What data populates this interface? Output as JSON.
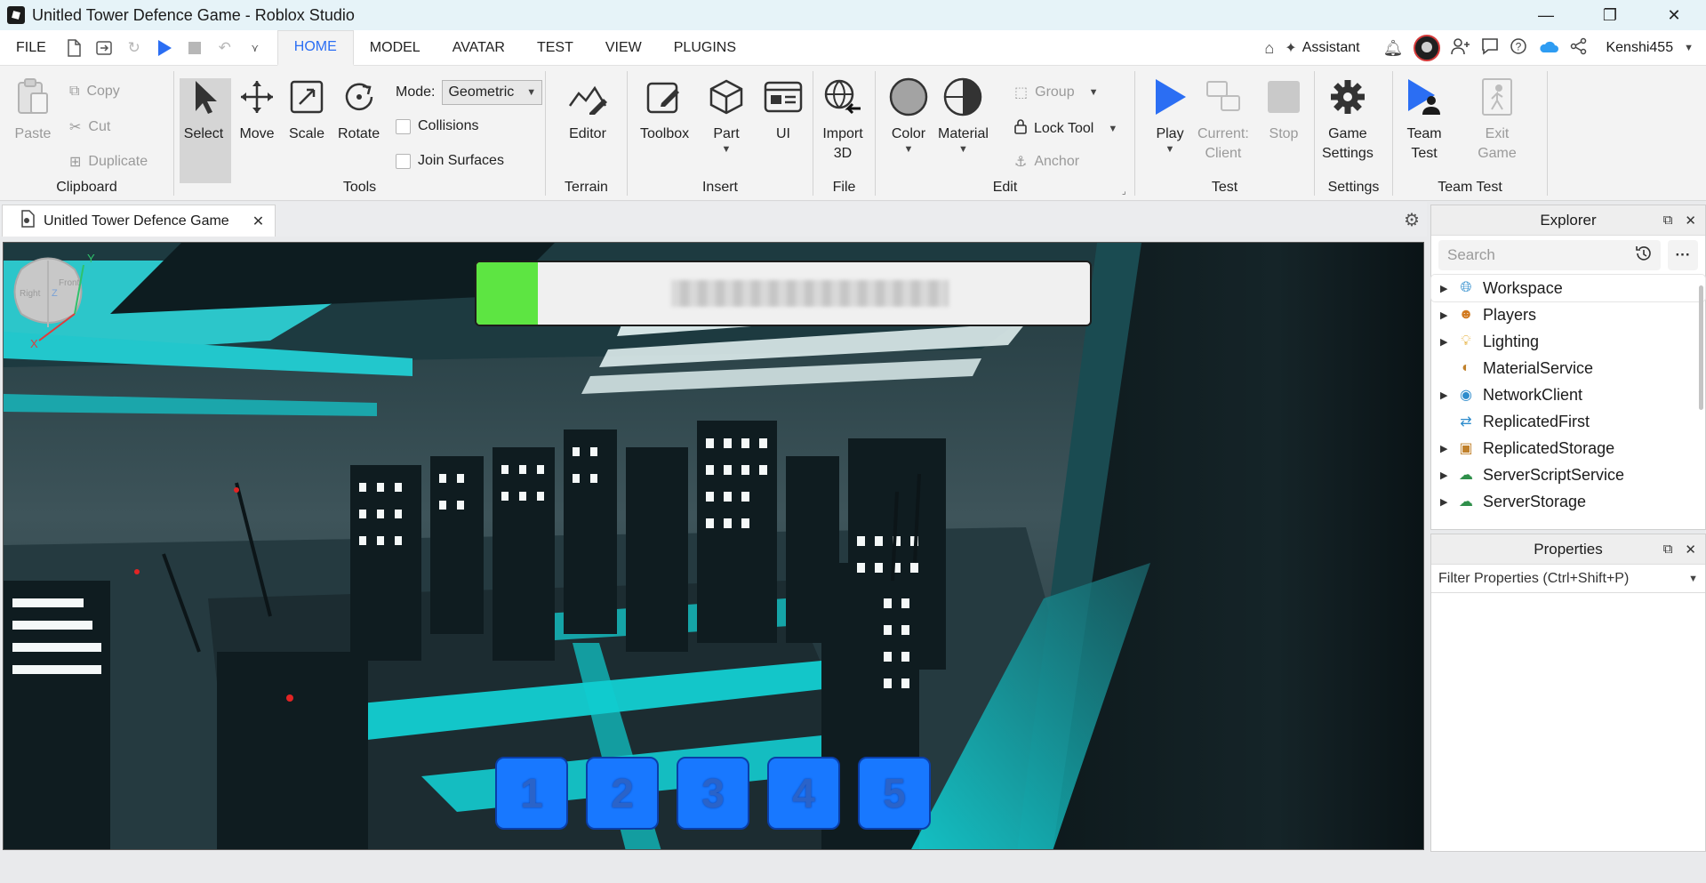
{
  "window": {
    "title": "Unitled Tower Defence Game - Roblox Studio",
    "controls": [
      "—",
      "❐",
      "✕"
    ]
  },
  "menubar": {
    "file": "FILE",
    "tabs": [
      "HOME",
      "MODEL",
      "AVATAR",
      "TEST",
      "VIEW",
      "PLUGINS"
    ],
    "active_tab": "HOME",
    "assistant": "Assistant",
    "username": "Kenshi455"
  },
  "ribbon": {
    "clipboard": {
      "label": "Clipboard",
      "paste": "Paste",
      "copy": "Copy",
      "cut": "Cut",
      "duplicate": "Duplicate"
    },
    "tools": {
      "label": "Tools",
      "select": "Select",
      "move": "Move",
      "scale": "Scale",
      "rotate": "Rotate",
      "mode_label": "Mode:",
      "mode_value": "Geometric",
      "collisions": "Collisions",
      "join_surfaces": "Join Surfaces"
    },
    "terrain": {
      "label": "Terrain",
      "editor": "Editor"
    },
    "insert": {
      "label": "Insert",
      "toolbox": "Toolbox",
      "part": "Part",
      "ui": "UI"
    },
    "file": {
      "label": "File",
      "import_l1": "Import",
      "import_l2": "3D"
    },
    "edit": {
      "label": "Edit",
      "color": "Color",
      "material": "Material",
      "group": "Group",
      "lock_tool": "Lock Tool",
      "anchor": "Anchor"
    },
    "test": {
      "label": "Test",
      "play": "Play",
      "current_l1": "Current:",
      "current_l2": "Client",
      "stop": "Stop"
    },
    "settings": {
      "label": "Settings",
      "game_l1": "Game",
      "game_l2": "Settings"
    },
    "team_test": {
      "label": "Team Test",
      "team_l1": "Team",
      "team_l2": "Test",
      "exit_l1": "Exit",
      "exit_l2": "Game"
    }
  },
  "document": {
    "tab_title": "Unitled Tower Defence Game",
    "tab_close": "✕"
  },
  "viewport": {
    "health_fill_fraction": 0.1,
    "slots": [
      "1",
      "2",
      "3",
      "4",
      "5"
    ],
    "gizmo_axes": {
      "x": "X",
      "y": "Y",
      "z": "Z",
      "right": "Right",
      "front": "Front"
    }
  },
  "explorer": {
    "title": "Explorer",
    "search_placeholder": "Search",
    "items": [
      {
        "label": "Workspace",
        "icon": "globe-icon",
        "expandable": true
      },
      {
        "label": "Players",
        "icon": "players-icon",
        "expandable": true
      },
      {
        "label": "Lighting",
        "icon": "bulb-icon",
        "expandable": true
      },
      {
        "label": "MaterialService",
        "icon": "material-icon",
        "expandable": false
      },
      {
        "label": "NetworkClient",
        "icon": "network-icon",
        "expandable": true
      },
      {
        "label": "ReplicatedFirst",
        "icon": "replicated-first-icon",
        "expandable": false
      },
      {
        "label": "ReplicatedStorage",
        "icon": "storage-icon",
        "expandable": true
      },
      {
        "label": "ServerScriptService",
        "icon": "script-service-icon",
        "expandable": true
      },
      {
        "label": "ServerStorage",
        "icon": "server-storage-icon",
        "expandable": true
      }
    ]
  },
  "properties": {
    "title": "Properties",
    "filter_placeholder": "Filter Properties (Ctrl+Shift+P)"
  },
  "colors": {
    "accent": "#2b6ef3",
    "health_green": "#5de542",
    "slot_blue": "#1878ff",
    "neon": "#1fe3e6"
  }
}
